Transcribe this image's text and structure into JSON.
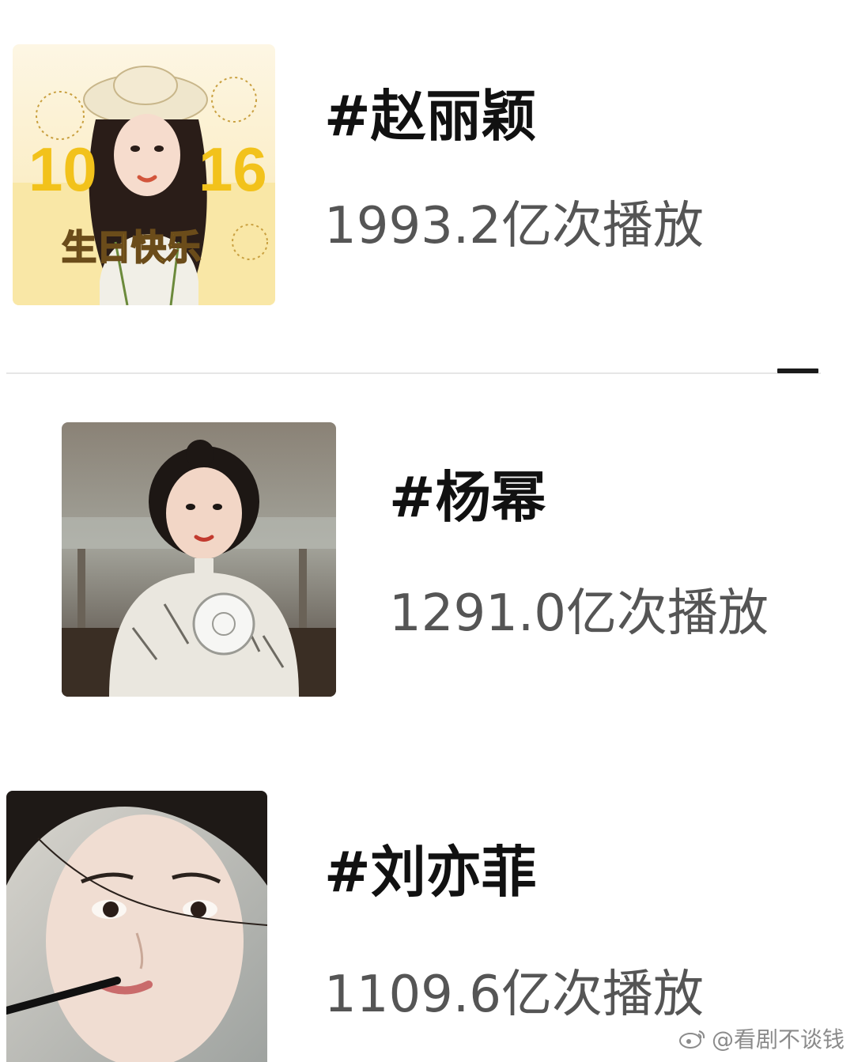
{
  "items": [
    {
      "title": "#赵丽颖",
      "plays": "1993.2亿次播放",
      "thumb": {
        "badge_left": "10",
        "badge_right": "16",
        "caption": "生日快乐",
        "bg": "#f9e7a6",
        "accent": "#f2c21b"
      }
    },
    {
      "title": "#杨幂",
      "plays": "1291.0亿次播放"
    },
    {
      "title": "#刘亦菲",
      "plays": "1109.6亿次播放"
    }
  ],
  "watermark": "@看剧不谈钱"
}
